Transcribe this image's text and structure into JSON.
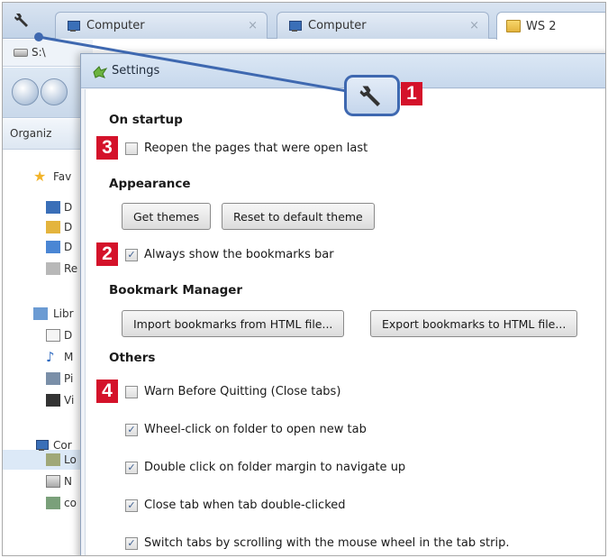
{
  "tabs": [
    {
      "label": "Computer",
      "icon": "computer-icon"
    },
    {
      "label": "Computer",
      "icon": "computer-icon"
    },
    {
      "label": "WS 2",
      "icon": "folder-icon"
    }
  ],
  "tab_close_glyph": "×",
  "explorer": {
    "address": "S:\\",
    "organize": "Organiz",
    "nav_items": [
      "Fav",
      "D",
      "D",
      "D",
      "Re",
      "Libr",
      "D",
      "M",
      "Pi",
      "Vi",
      "Cor",
      "Lo",
      "N",
      "co"
    ]
  },
  "dialog": {
    "title": "Settings",
    "sections": {
      "startup": "On startup",
      "appearance": "Appearance",
      "bookmark_manager": "Bookmark Manager",
      "others": "Others"
    },
    "options": {
      "reopen_pages": {
        "label": "Reopen the pages that were open last",
        "checked": false
      },
      "always_show_bookmarks": {
        "label": "Always show the bookmarks bar",
        "checked": true
      },
      "warn_before_quitting": {
        "label": "Warn Before Quitting (Close tabs)",
        "checked": false
      },
      "wheel_click_folder": {
        "label": "Wheel-click on folder to open new tab",
        "checked": true
      },
      "double_click_margin": {
        "label": "Double click on folder margin to navigate up",
        "checked": true
      },
      "close_tab_double_click": {
        "label": "Close tab when tab double-clicked",
        "checked": true
      },
      "switch_tabs_scroll": {
        "label": "Switch tabs by scrolling with the mouse wheel in the tab strip.",
        "checked": true
      }
    },
    "buttons": {
      "get_themes": "Get themes",
      "reset_theme": "Reset to default theme",
      "import_bookmarks": "Import bookmarks from HTML file...",
      "export_bookmarks": "Export bookmarks to HTML file..."
    }
  },
  "callouts": [
    "1",
    "2",
    "3",
    "4"
  ],
  "colors": {
    "callout_red": "#d4122a",
    "callout_blue": "#3e68b0",
    "check_mark": "#3d5f91"
  }
}
